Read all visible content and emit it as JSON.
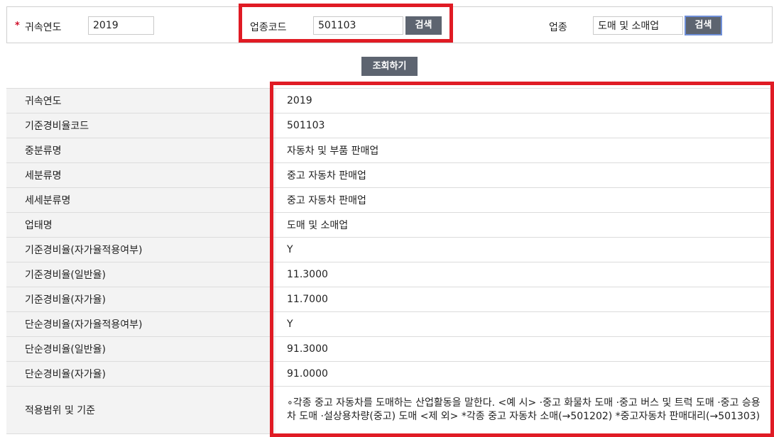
{
  "search": {
    "required_mark": "*",
    "year_label": "귀속연도",
    "year_value": "2019",
    "code_label": "업종코드",
    "code_value": "501103",
    "code_search_label": "검색",
    "industry_label": "업종",
    "industry_value": "도매 및 소매업",
    "industry_search_label": "검색",
    "query_button": "조회하기"
  },
  "rows": [
    {
      "label": "귀속연도",
      "value": "2019"
    },
    {
      "label": "기준경비율코드",
      "value": "501103"
    },
    {
      "label": "중분류명",
      "value": "자동차 및 부품 판매업"
    },
    {
      "label": "세분류명",
      "value": "중고 자동차 판매업"
    },
    {
      "label": "세세분류명",
      "value": "중고 자동차 판매업"
    },
    {
      "label": "업태명",
      "value": "도매 및 소매업"
    },
    {
      "label": "기준경비율(자가율적용여부)",
      "value": "Y"
    },
    {
      "label": "기준경비율(일반율)",
      "value": "11.3000"
    },
    {
      "label": "기준경비율(자가율)",
      "value": "11.7000"
    },
    {
      "label": "단순경비율(자가율적용여부)",
      "value": "Y"
    },
    {
      "label": "단순경비율(일반율)",
      "value": "91.3000"
    },
    {
      "label": "단순경비율(자가율)",
      "value": "91.0000"
    },
    {
      "label": "적용범위 및 기준",
      "value": "∘각종 중고 자동차를 도매하는 산업활동을 말한다. <예 시> ·중고 화물차 도매 ·중고 버스 및 트럭 도매 ·중고 승용차 도매 ·설상용차량(중고) 도매 <제 외> *각종 중고 자동차 소매(→501202) *중고자동차 판매대리(→501303)"
    }
  ],
  "colors": {
    "highlight": "#e01b24",
    "button_bg": "#5d6470",
    "header_cell_bg": "#f3f3f3"
  }
}
